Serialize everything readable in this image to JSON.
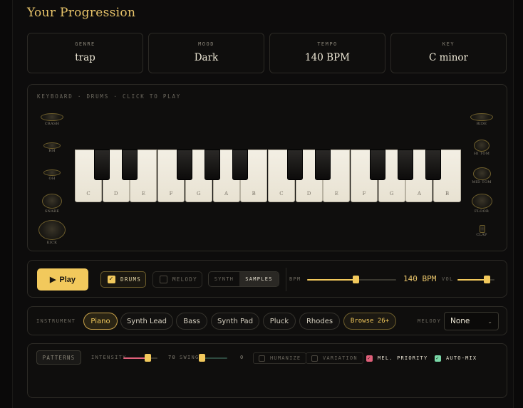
{
  "title": "Your Progression",
  "info": [
    {
      "label": "GENRE",
      "value": "trap"
    },
    {
      "label": "MOOD",
      "value": "Dark"
    },
    {
      "label": "TEMPO",
      "value": "140 BPM"
    },
    {
      "label": "KEY",
      "value": "C minor"
    }
  ],
  "keyboard": {
    "title": "KEYBOARD · DRUMS · CLICK TO PLAY",
    "white_keys": [
      "C",
      "D",
      "E",
      "F",
      "G",
      "A",
      "B",
      "C",
      "D",
      "E",
      "F",
      "G",
      "A",
      "B"
    ],
    "drums_left": [
      "CRASH",
      "HH",
      "OH",
      "SNARE",
      "KICK"
    ],
    "drums_right": [
      "RIDE",
      "HI TOM",
      "MID TOM",
      "FLOOR",
      "CLAP"
    ]
  },
  "controls": {
    "play_label": "Play",
    "play_icon": "play-icon",
    "drums_label": "DRUMS",
    "drums_checked": true,
    "melody_label": "MELODY",
    "melody_checked": false,
    "synth_label": "SYNTH",
    "samples_label": "SAMPLES",
    "samples_selected": true,
    "bpm_label": "BPM",
    "bpm_value": "140 BPM",
    "bpm_level": 0.54,
    "vol_label": "VOL",
    "vol_level": 0.78
  },
  "instrument": {
    "label": "INSTRUMENT",
    "options": [
      "Piano",
      "Synth Lead",
      "Bass",
      "Synth Pad",
      "Pluck",
      "Rhodes"
    ],
    "selected": "Piano",
    "browse_label": "Browse 26+",
    "melody_label": "MELODY",
    "melody_value": "None"
  },
  "patterns": {
    "patterns_label": "PATTERNS",
    "intensity_label": "INTENSITY",
    "intensity_value": "70",
    "intensity_level": 0.7,
    "swing_label": "SWING",
    "swing_value": "0",
    "swing_level": 0,
    "humanize_label": "HUMANIZE",
    "humanize_checked": false,
    "variation_label": "VARIATION",
    "variation_checked": false,
    "mel_priority_label": "MEL. PRIORITY",
    "mel_priority_checked": true,
    "auto_mix_label": "AUTO-MIX",
    "auto_mix_checked": true
  },
  "colors": {
    "accent": "#f2c95c",
    "pink": "#e0607a",
    "green": "#7ad9a8",
    "background": "#0d0c0c"
  }
}
